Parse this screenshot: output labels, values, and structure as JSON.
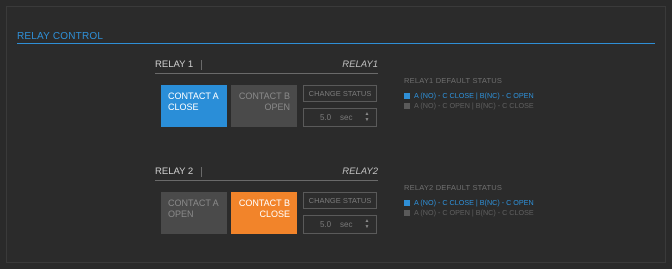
{
  "panel": {
    "title": "RELAY CONTROL"
  },
  "relays": [
    {
      "label": "RELAY 1",
      "name": "RELAY1",
      "contact_a": {
        "line1": "CONTACT A",
        "line2": "CLOSE",
        "active": true
      },
      "contact_b": {
        "line1": "CONTACT B",
        "line2": "OPEN",
        "active": false
      },
      "change_status_label": "CHANGE STATUS",
      "duration_value": "5.0",
      "duration_unit": "sec",
      "default_status_title": "RELAY1 DEFAULT STATUS",
      "options": [
        {
          "label": "A (NO) - C CLOSE | B(NC) - C OPEN",
          "selected": true
        },
        {
          "label": "A (NO) - C OPEN | B(NC) - C CLOSE",
          "selected": false
        }
      ]
    },
    {
      "label": "RELAY 2",
      "name": "RELAY2",
      "contact_a": {
        "line1": "CONTACT A",
        "line2": "OPEN",
        "active": false
      },
      "contact_b": {
        "line1": "CONTACT B",
        "line2": "CLOSE",
        "active": true
      },
      "change_status_label": "CHANGE STATUS",
      "duration_value": "5.0",
      "duration_unit": "sec",
      "default_status_title": "RELAY2 DEFAULT STATUS",
      "options": [
        {
          "label": "A (NO) - C CLOSE | B(NC) - C OPEN",
          "selected": true
        },
        {
          "label": "A (NO) - C OPEN | B(NC) - C CLOSE",
          "selected": false
        }
      ]
    }
  ],
  "colors": {
    "accent_blue": "#2a8ed8",
    "accent_orange": "#f2842a",
    "background": "#2b2b2b"
  },
  "icons": {
    "spinner": "up-down-arrows-icon",
    "option_marker": "square-bullet-icon"
  }
}
